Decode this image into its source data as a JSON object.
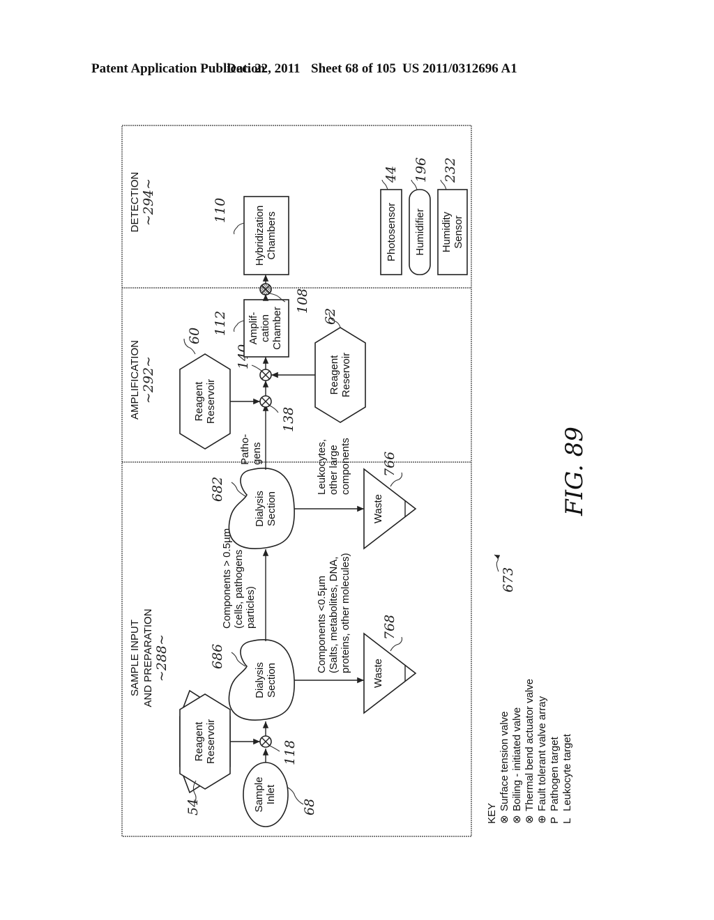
{
  "header": {
    "title": "Patent Application Publication",
    "date": "Dec. 22, 2011",
    "sheet": "Sheet 68 of 105",
    "number": "US 2011/0312696 A1"
  },
  "figure": {
    "label": "FIG. 89",
    "ref": "673"
  },
  "sections": [
    {
      "title_lines": [
        "SAMPLE INPUT",
        "AND PREPARATION"
      ],
      "ref": "~288~"
    },
    {
      "title_lines": [
        "AMPLIFICATION"
      ],
      "ref": "~292~"
    },
    {
      "title_lines": [
        "DETECTION"
      ],
      "ref": "~294~"
    }
  ],
  "nodes": {
    "sample_inlet": {
      "lines": [
        "Sample",
        "Inlet"
      ],
      "ref": "68"
    },
    "reagent_54": {
      "lines": [
        "Reagent",
        "Reservoir"
      ],
      "ref": "54"
    },
    "valve_118": {
      "ref": "118"
    },
    "dialysis_686": {
      "lines": [
        "Dialysis",
        "Section"
      ],
      "ref": "686"
    },
    "dialysis_682": {
      "lines": [
        "Dialysis",
        "Section"
      ],
      "ref": "682"
    },
    "waste_768": {
      "lines": [
        "Waste"
      ],
      "ref": "768"
    },
    "waste_766": {
      "lines": [
        "Waste"
      ],
      "ref": "766"
    },
    "reagent_60": {
      "lines": [
        "Reagent",
        "Reservoir"
      ],
      "ref": "60"
    },
    "reagent_62": {
      "lines": [
        "Reagent",
        "Reservoir"
      ],
      "ref": "62"
    },
    "valve_138": {
      "ref": "138"
    },
    "valve_140": {
      "ref": "140"
    },
    "amplification_chamber": {
      "lines": [
        "Amplif-",
        "cation",
        "Chamber"
      ],
      "ref": "112"
    },
    "valve_108": {
      "ref": "108"
    },
    "hybridization_chambers": {
      "lines": [
        "Hybridization",
        "Chambers"
      ],
      "ref": "110"
    },
    "photosensor": {
      "lines": [
        "Photosensor"
      ],
      "ref": "44"
    },
    "humidifier": {
      "lines": [
        "Humidifier"
      ],
      "ref": "196"
    },
    "humidity_sensor": {
      "lines": [
        "Humidity",
        "Sensor"
      ],
      "ref": "232"
    }
  },
  "flow_labels": {
    "components_gt": [
      "Components > 0.5µm",
      "(cells, pathogens",
      "particles)"
    ],
    "components_lt": [
      "Components <0.5µm",
      "(Salts, metabolites, DNA,",
      "proteins, other molecules)"
    ],
    "leukocytes": [
      "Leukocytes,",
      "other large",
      "components"
    ],
    "pathogens": [
      "Patho-",
      "gens"
    ]
  },
  "key": {
    "title": "KEY",
    "items": [
      {
        "symbol": "⊗",
        "label": "Surface tension valve"
      },
      {
        "symbol": "⊗",
        "label": "Boiling - initiated valve"
      },
      {
        "symbol": "⊗",
        "label": "Thermal bend actuator valve"
      },
      {
        "symbol": "⊕",
        "label": "Fault tolerant valve array"
      },
      {
        "symbol": "P",
        "label": "Pathogen target"
      },
      {
        "symbol": "L",
        "label": "Leukocyte target"
      }
    ]
  }
}
